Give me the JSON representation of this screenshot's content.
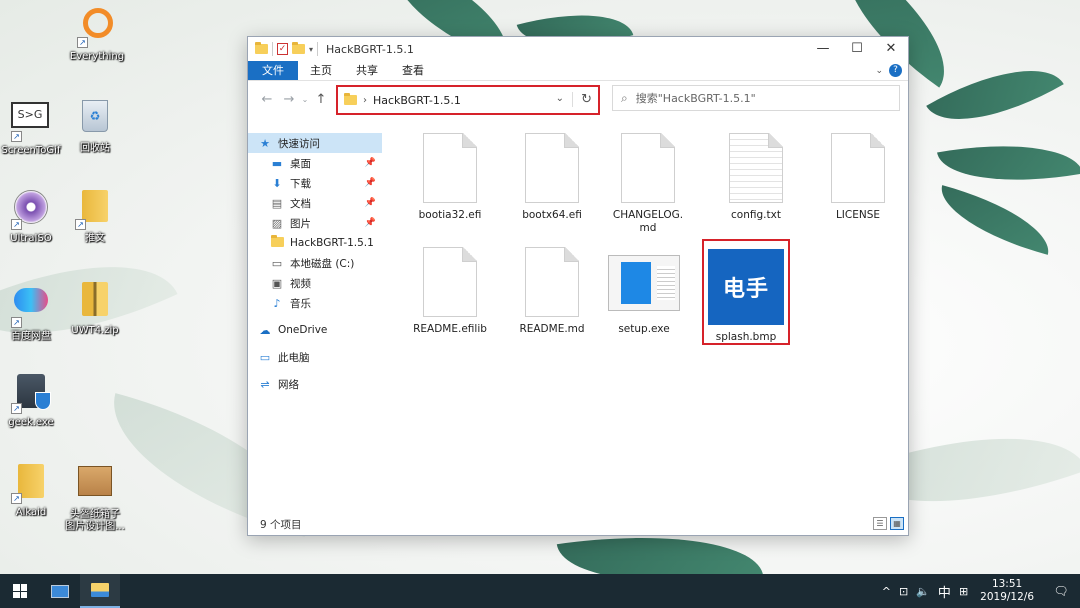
{
  "desktop_icons": [
    {
      "label": "Everything",
      "icon": "magnifier-orange-icon"
    },
    {
      "label": "ScreenToGif",
      "icon": "screentogif-icon"
    },
    {
      "label": "回收站",
      "icon": "recycle-bin-icon"
    },
    {
      "label": "UltraISO",
      "icon": "disc-icon"
    },
    {
      "label": "推文",
      "icon": "folder-icon"
    },
    {
      "label": "百度网盘",
      "icon": "baidu-cloud-icon"
    },
    {
      "label": "UWT4.zip",
      "icon": "zip-folder-icon"
    },
    {
      "label": "geek.exe",
      "icon": "geek-uninstaller-icon"
    },
    {
      "label": "Alkaid",
      "icon": "folder-icon"
    },
    {
      "label": "头盔纸箱子",
      "label2": "图片设计图...",
      "icon": "box-icon"
    }
  ],
  "window": {
    "title": "HackBGRT-1.5.1",
    "controls": {
      "minimize": "—",
      "maximize": "☐",
      "close": "✕"
    },
    "ribbon_tabs": [
      "文件",
      "主页",
      "共享",
      "查看"
    ],
    "address": {
      "crumb": "HackBGRT-1.5.1"
    },
    "search_placeholder": "搜索\"HackBGRT-1.5.1\""
  },
  "sidebar": [
    {
      "label": "快速访问",
      "icon": "star-icon",
      "level": "top",
      "active": true
    },
    {
      "label": "桌面",
      "icon": "desktop-icon",
      "pinned": true
    },
    {
      "label": "下载",
      "icon": "download-arrow-icon",
      "pinned": true
    },
    {
      "label": "文档",
      "icon": "document-icon",
      "pinned": true
    },
    {
      "label": "图片",
      "icon": "picture-icon",
      "pinned": true
    },
    {
      "label": "HackBGRT-1.5.1",
      "icon": "folder-icon"
    },
    {
      "label": "本地磁盘 (C:)",
      "icon": "drive-icon"
    },
    {
      "label": "视频",
      "icon": "video-icon"
    },
    {
      "label": "音乐",
      "icon": "music-note-icon"
    },
    {
      "label": "OneDrive",
      "icon": "cloud-icon",
      "level": "top"
    },
    {
      "label": "此电脑",
      "icon": "computer-icon",
      "level": "top"
    },
    {
      "label": "网络",
      "icon": "network-icon",
      "level": "top"
    }
  ],
  "files": [
    {
      "name": "bootia32.efi",
      "kind": "blank"
    },
    {
      "name": "bootx64.efi",
      "kind": "blank"
    },
    {
      "name": "CHANGELOG.md",
      "kind": "blank"
    },
    {
      "name": "config.txt",
      "kind": "lines"
    },
    {
      "name": "LICENSE",
      "kind": "blank"
    },
    {
      "name": "README.efilib",
      "kind": "blank"
    },
    {
      "name": "README.md",
      "kind": "blank"
    },
    {
      "name": "setup.exe",
      "kind": "setup"
    },
    {
      "name": "splash.bmp",
      "kind": "splash",
      "thumb_text": "电手"
    }
  ],
  "status": {
    "count": "9 个项目"
  },
  "taskbar": {
    "time": "13:51",
    "date": "2019/12/6",
    "ime": "中",
    "apps": [
      "explorer-pc-icon",
      "file-explorer-icon"
    ]
  },
  "colors": {
    "accent": "#1a6fc4",
    "highlight": "#d6222a",
    "taskbar": "#1b2a33"
  }
}
